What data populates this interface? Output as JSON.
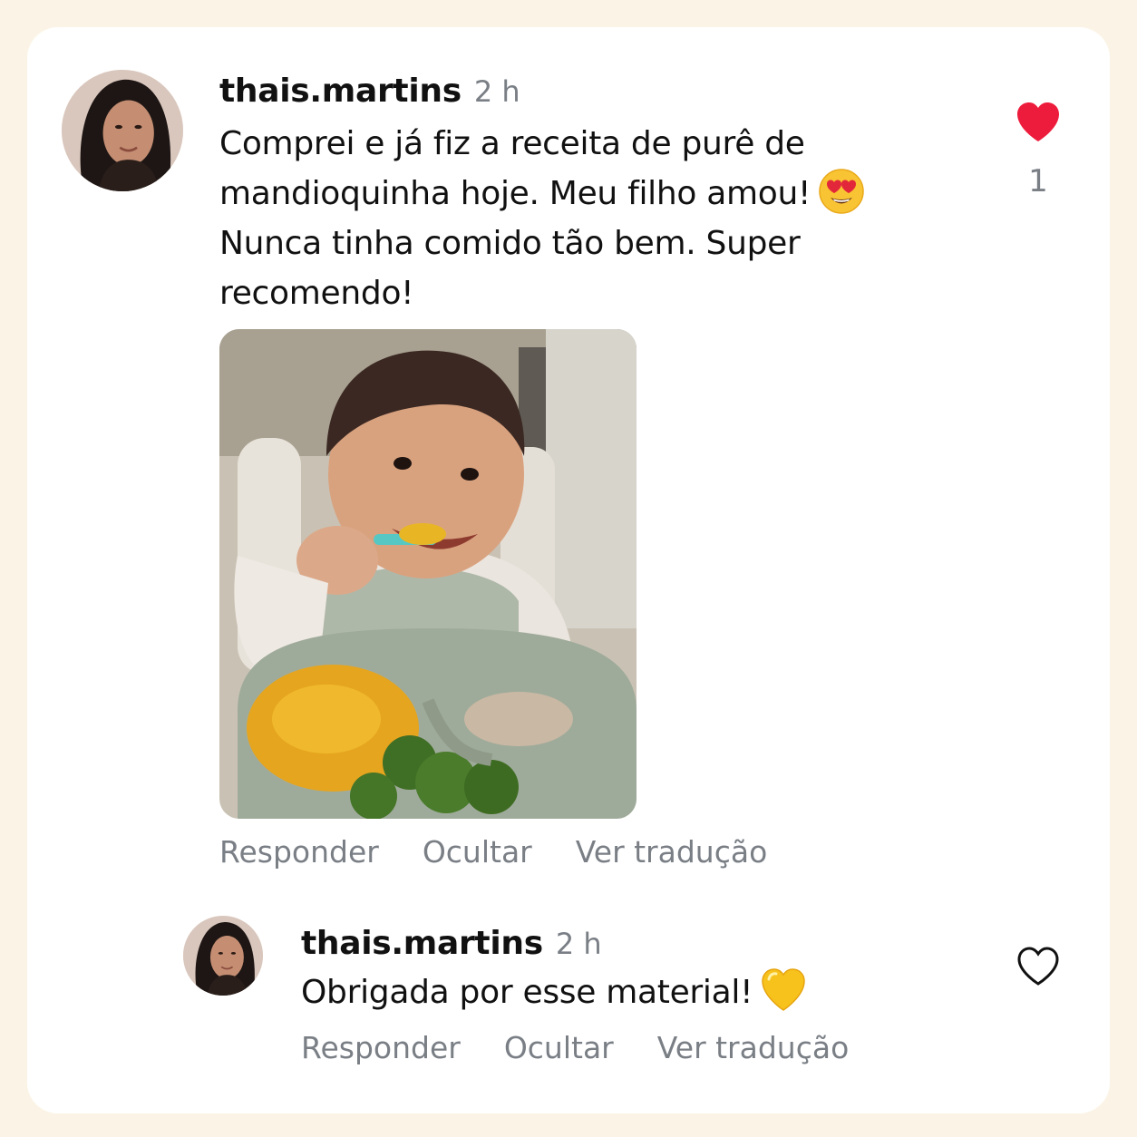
{
  "comment": {
    "username": "thais.martins",
    "time": "2 h",
    "text_before_emoji": "Comprei e já fiz a receita de purê de mandioquinha hoje. Meu filho amou!",
    "emoji": "heart-eyes-emoji",
    "text_after_emoji": "Nunca tinha comido tão bem. Super recomendo!",
    "photo": "baby-eating-puree-photo",
    "like_count": "1",
    "liked": true,
    "actions": {
      "reply": "Responder",
      "hide": "Ocultar",
      "translate": "Ver tradução"
    }
  },
  "reply": {
    "username": "thais.martins",
    "time": "2 h",
    "text": "Obrigada por esse material!",
    "emoji": "yellow-heart-emoji",
    "liked": false,
    "actions": {
      "reply": "Responder",
      "hide": "Ocultar",
      "translate": "Ver tradução"
    }
  },
  "colors": {
    "background": "#fbf4e6",
    "card": "#ffffff",
    "like_active": "#ee1c3c",
    "secondary_text": "#7a7f86"
  }
}
